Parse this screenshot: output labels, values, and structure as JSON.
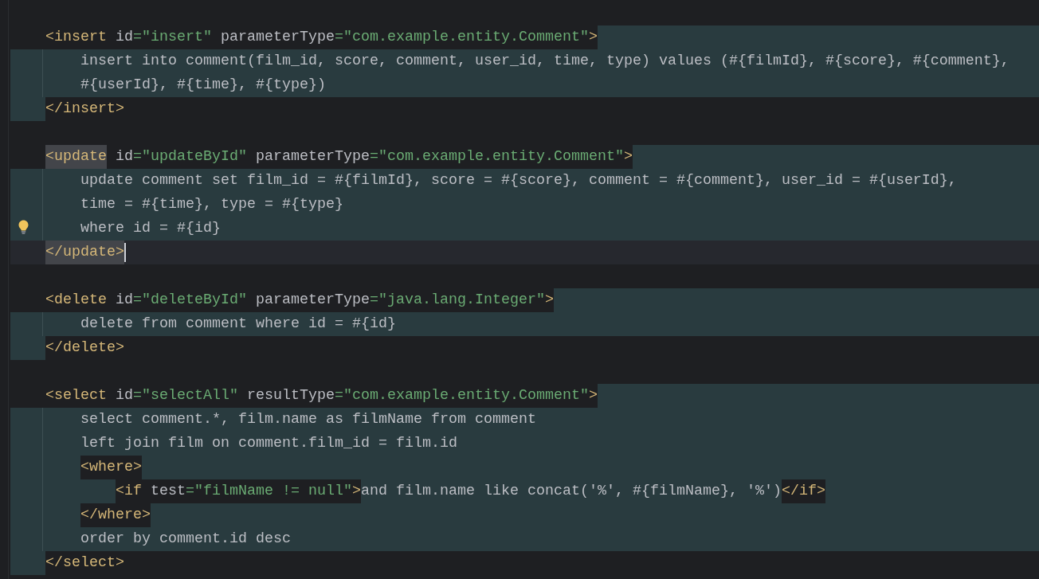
{
  "editor": {
    "code": [
      {
        "kind": "block",
        "injected": true,
        "open": {
          "tag": "<insert",
          "attrs": [
            {
              "name": "id",
              "value": "=\"insert\""
            },
            {
              "name": "parameterType",
              "value": "=\"com.example.entity.Comment\""
            }
          ],
          "end": ">",
          "matched": false
        },
        "children": [
          {
            "kind": "sql",
            "text": "insert into comment(film_id, score, comment, user_id, time, type) values (#{filmId}, #{score}, #{comment},"
          },
          {
            "kind": "sql",
            "text": "#{userId}, #{time}, #{type})"
          }
        ],
        "close": {
          "tag": "</insert>",
          "matched": false,
          "caret": false
        }
      },
      {
        "kind": "block",
        "injected": true,
        "open": {
          "tag": "<update",
          "attrs": [
            {
              "name": "id",
              "value": "=\"updateById\""
            },
            {
              "name": "parameterType",
              "value": "=\"com.example.entity.Comment\""
            }
          ],
          "end": ">",
          "matched": true
        },
        "children": [
          {
            "kind": "sql",
            "text": "update comment set film_id = #{filmId}, score = #{score}, comment = #{comment}, user_id = #{userId},"
          },
          {
            "kind": "sql",
            "text": "time = #{time}, type = #{type}"
          },
          {
            "kind": "sql",
            "text": "where id = #{id}",
            "bulb": true
          }
        ],
        "close": {
          "tag": "</update>",
          "matched": true,
          "caret": true
        }
      },
      {
        "kind": "block",
        "injected": true,
        "open": {
          "tag": "<delete",
          "attrs": [
            {
              "name": "id",
              "value": "=\"deleteById\""
            },
            {
              "name": "parameterType",
              "value": "=\"java.lang.Integer\""
            }
          ],
          "end": ">",
          "matched": false
        },
        "children": [
          {
            "kind": "sql",
            "text": "delete from comment where id = #{id}"
          }
        ],
        "close": {
          "tag": "</delete>",
          "matched": false,
          "caret": false
        }
      },
      {
        "kind": "block",
        "injected": true,
        "open": {
          "tag": "<select",
          "attrs": [
            {
              "name": "id",
              "value": "=\"selectAll\""
            },
            {
              "name": "resultType",
              "value": "=\"com.example.entity.Comment\""
            }
          ],
          "end": ">",
          "matched": false
        },
        "children": [
          {
            "kind": "sql",
            "text": "select comment.*, film.name as filmName from comment"
          },
          {
            "kind": "sql",
            "text": "left join film on comment.film_id = film.id"
          },
          {
            "kind": "block",
            "open": {
              "tag": "<where>",
              "matched": false
            },
            "children": [
              {
                "kind": "inline",
                "open": {
                  "tag": "<if",
                  "attrs": [
                    {
                      "name": "test",
                      "value": "=\"filmName != null\""
                    }
                  ],
                  "end": ">",
                  "matched": false
                },
                "children": [
                  {
                    "kind": "sql",
                    "text": "and film.name like concat('%', #{filmName}, '%')"
                  }
                ],
                "close": {
                  "tag": "</if>",
                  "matched": false,
                  "caret": false
                }
              }
            ],
            "close": {
              "tag": "</where>",
              "matched": false,
              "caret": false
            }
          },
          {
            "kind": "sql",
            "text": "order by comment.id desc"
          }
        ],
        "close": {
          "tag": "</select>",
          "matched": false,
          "caret": false
        }
      }
    ]
  }
}
